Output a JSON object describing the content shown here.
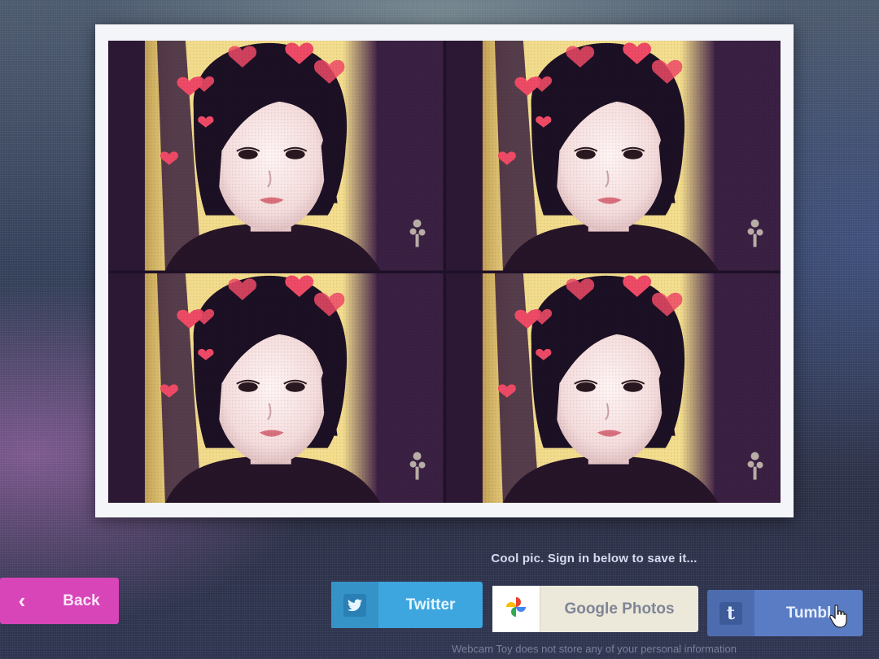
{
  "share": {
    "prompt": "Cool pic. Sign in below to save it...",
    "buttons": {
      "back": "Back",
      "twitter": "Twitter",
      "google_photos": "Google Photos",
      "tumblr": "Tumbl"
    }
  },
  "footer": {
    "note": "Webcam Toy does not store any of your personal information"
  },
  "photo_strip": {
    "layout": "2x2",
    "frames": 4,
    "effect": "heart-crown"
  },
  "colors": {
    "back": "#d845b8",
    "twitter": "#3ea6de",
    "google_photos": "#ece8da",
    "tumblr": "#5a7cc4"
  }
}
